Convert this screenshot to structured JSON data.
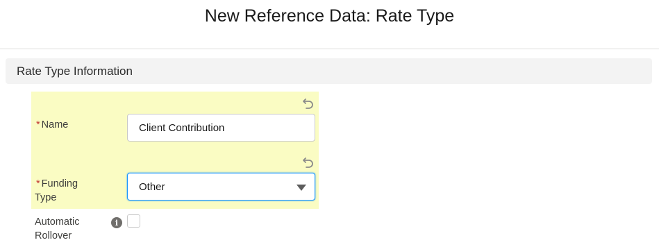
{
  "modal": {
    "title": "New Reference Data: Rate Type"
  },
  "section": {
    "title": "Rate Type Information"
  },
  "fields": {
    "name": {
      "required_marker": "*",
      "label": "Name",
      "value": "Client Contribution"
    },
    "funding_type": {
      "required_marker": "*",
      "label_line1": "Funding",
      "label_line2": "Type",
      "value": "Other"
    },
    "automatic_rollover": {
      "label_line1": "Automatic",
      "label_line2": "Rollover",
      "info_glyph": "i",
      "checked": false
    }
  },
  "icons": {
    "undo": "undo-icon",
    "caret": "chevron-down-icon",
    "info": "info-icon"
  },
  "colors": {
    "edited_highlight": "#fafcc3",
    "required": "#c23934",
    "focus_border": "#1b96ff"
  }
}
